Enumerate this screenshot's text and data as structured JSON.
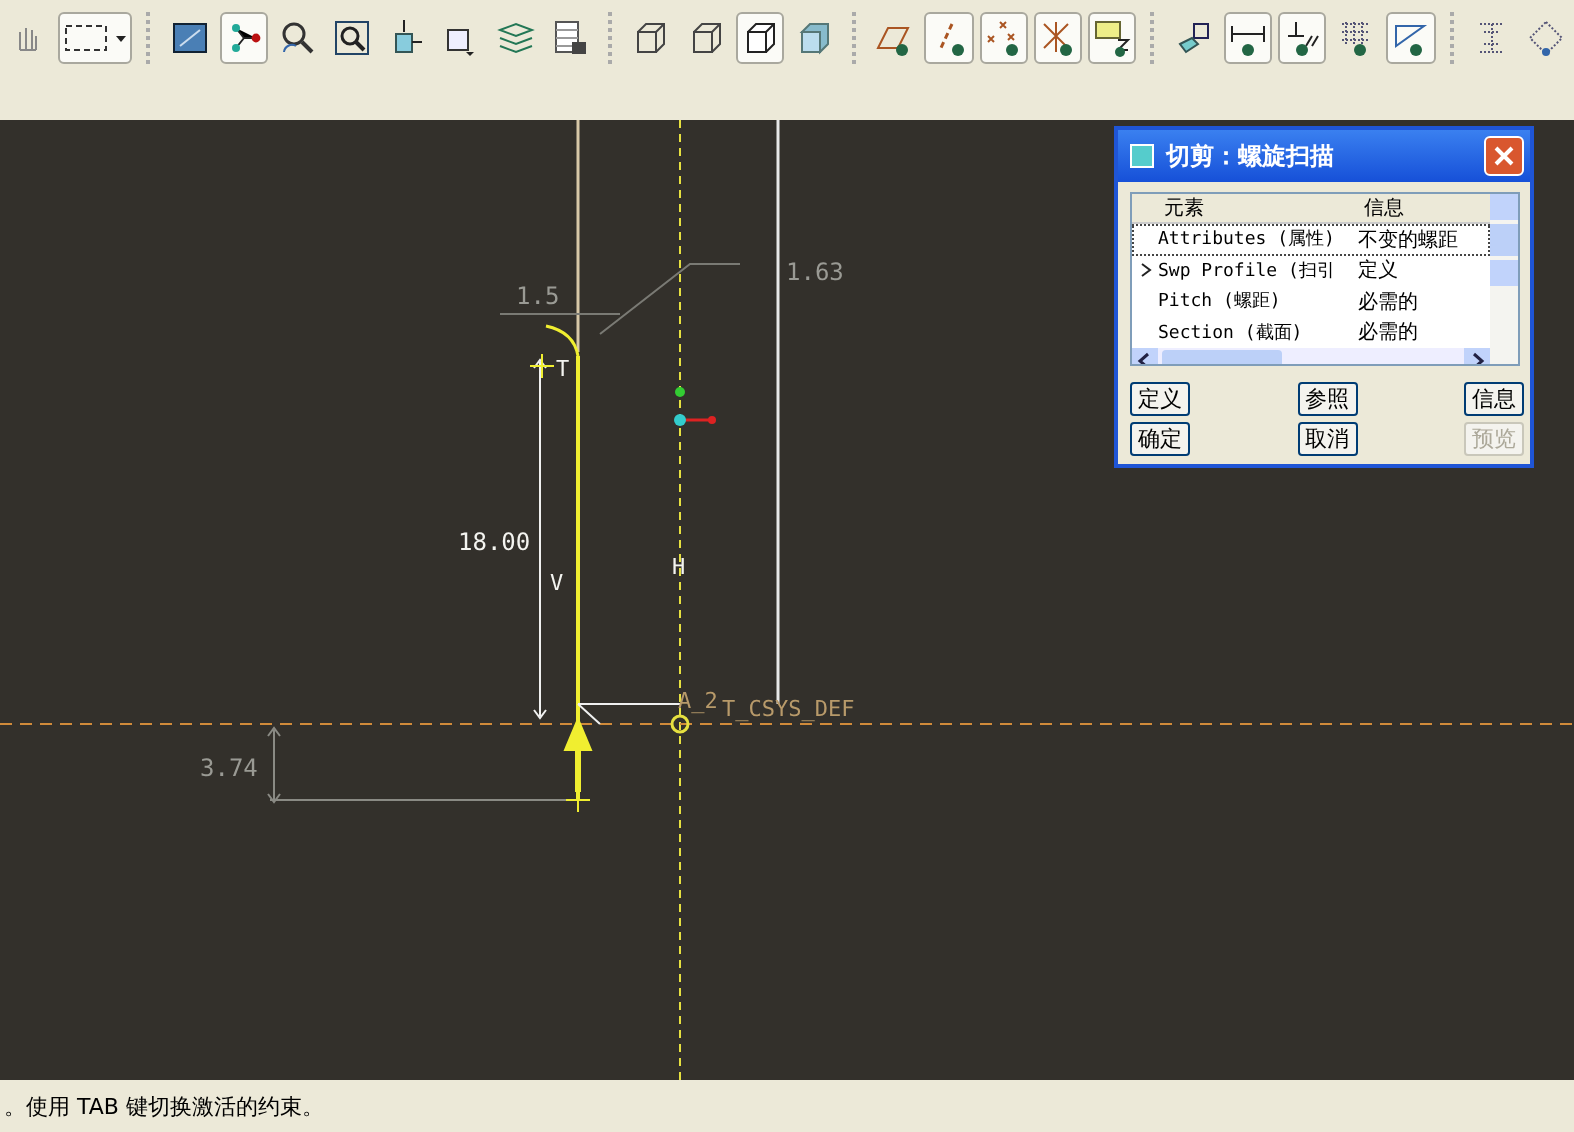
{
  "toolbar": {
    "items": [
      {
        "kind": "hand",
        "selected": false
      },
      {
        "kind": "select-box",
        "selected": true
      },
      {
        "kind": "sep"
      },
      {
        "kind": "monitor",
        "selected": false
      },
      {
        "kind": "nodes",
        "selected": true
      },
      {
        "kind": "gear-search",
        "selected": false
      },
      {
        "kind": "zoom",
        "selected": false
      },
      {
        "kind": "cube-arrow",
        "selected": false
      },
      {
        "kind": "box-caret",
        "selected": false
      },
      {
        "kind": "layers",
        "selected": false
      },
      {
        "kind": "table",
        "selected": false
      },
      {
        "kind": "sep"
      },
      {
        "kind": "wire-cube",
        "selected": false
      },
      {
        "kind": "wire-cube",
        "selected": false
      },
      {
        "kind": "cube",
        "selected": true
      },
      {
        "kind": "solid-cube",
        "selected": false
      },
      {
        "kind": "sep"
      },
      {
        "kind": "parallelogram",
        "selected": false
      },
      {
        "kind": "slash",
        "selected": true
      },
      {
        "kind": "crosses",
        "selected": true
      },
      {
        "kind": "axes",
        "selected": true
      },
      {
        "kind": "rect-z",
        "selected": true
      },
      {
        "kind": "sep"
      },
      {
        "kind": "copy",
        "selected": false
      },
      {
        "kind": "dimension",
        "selected": true
      },
      {
        "kind": "perpendicular",
        "selected": true
      },
      {
        "kind": "grid",
        "selected": false
      },
      {
        "kind": "triangle",
        "selected": true
      },
      {
        "kind": "sep"
      },
      {
        "kind": "beam",
        "selected": false
      },
      {
        "kind": "diamond",
        "selected": false
      }
    ]
  },
  "canvas": {
    "labels": [
      {
        "kind": "dim",
        "text": "1.63"
      },
      {
        "kind": "dim",
        "text": "1.5"
      },
      {
        "kind": "tag",
        "text": "T"
      },
      {
        "kind": "value",
        "text": "18.00"
      },
      {
        "kind": "tag",
        "text": "V"
      },
      {
        "kind": "tag",
        "text": "H"
      },
      {
        "kind": "ref",
        "text": "A_2"
      },
      {
        "kind": "ref",
        "text": "T_CSYS_DEF"
      },
      {
        "kind": "dim",
        "text": "3.74"
      }
    ]
  },
  "dialog": {
    "title": "切剪：螺旋扫描",
    "columns": [
      "元素",
      "信息"
    ],
    "rows": [
      {
        "element": "Attributes (属性)",
        "info": "不变的螺距",
        "current": false,
        "focused": true
      },
      {
        "element": "Swp Profile (扫引",
        "info": "定义",
        "current": true,
        "focused": false
      },
      {
        "element": "Pitch (螺距)",
        "info": "必需的",
        "current": false,
        "focused": false
      },
      {
        "element": "Section (截面)",
        "info": "必需的",
        "current": false,
        "focused": false
      }
    ],
    "buttons": [
      {
        "label": "定义",
        "disabled": false
      },
      {
        "label": "参照",
        "disabled": false
      },
      {
        "label": "信息",
        "disabled": false
      },
      {
        "label": "确定",
        "disabled": false
      },
      {
        "label": "取消",
        "disabled": false
      },
      {
        "label": "预览",
        "disabled": true
      }
    ]
  },
  "status_bar": {
    "message": "。使用 TAB 键切换激活的约束。"
  }
}
